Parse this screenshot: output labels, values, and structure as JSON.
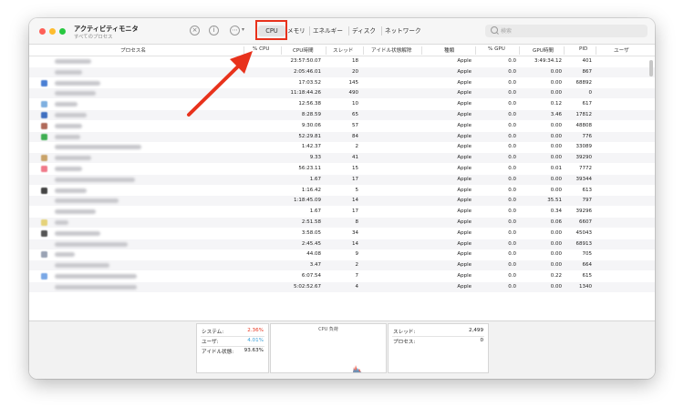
{
  "window": {
    "app_title": "アクティビティモニタ",
    "app_subtitle": "すべてのプロセス"
  },
  "toolbar": {
    "tabs": [
      "CPU",
      "メモリ",
      "エネルギー",
      "ディスク",
      "ネットワーク"
    ],
    "selected_tab": "CPU",
    "search_placeholder": "検索",
    "icons": [
      "stop-icon",
      "info-icon",
      "more-icon"
    ]
  },
  "columns": [
    "プロセス名",
    "% CPU",
    "CPU時間",
    "スレッド",
    "アイドル状態解除",
    "種類",
    "% GPU",
    "GPU時間",
    "PID",
    "ユーザ"
  ],
  "rows": [
    {
      "cpu_time": "23:57:50.07",
      "threads": "18",
      "kind": "Apple",
      "gpu": "0.0",
      "gpu_time": "3:49:34.12",
      "pid": "401"
    },
    {
      "cpu_time": "2:05:46.01",
      "threads": "20",
      "kind": "Apple",
      "gpu": "0.0",
      "gpu_time": "0.00",
      "pid": "867"
    },
    {
      "cpu_time": "17:03.52",
      "threads": "145",
      "kind": "Apple",
      "gpu": "0.0",
      "gpu_time": "0.00",
      "pid": "68892"
    },
    {
      "cpu_time": "11:18:44.26",
      "threads": "490",
      "kind": "Apple",
      "gpu": "0.0",
      "gpu_time": "0.00",
      "pid": "0"
    },
    {
      "cpu_time": "12:56.38",
      "threads": "10",
      "kind": "Apple",
      "gpu": "0.0",
      "gpu_time": "0.12",
      "pid": "617"
    },
    {
      "cpu_time": "8:28.59",
      "threads": "65",
      "kind": "Apple",
      "gpu": "0.0",
      "gpu_time": "3.46",
      "pid": "17812"
    },
    {
      "cpu_time": "9:30.06",
      "threads": "57",
      "kind": "Apple",
      "gpu": "0.0",
      "gpu_time": "0.00",
      "pid": "48808"
    },
    {
      "cpu_time": "52:29.81",
      "threads": "84",
      "kind": "Apple",
      "gpu": "0.0",
      "gpu_time": "0.00",
      "pid": "776"
    },
    {
      "cpu_time": "1:42.37",
      "threads": "2",
      "kind": "Apple",
      "gpu": "0.0",
      "gpu_time": "0.00",
      "pid": "33089"
    },
    {
      "cpu_time": "9.33",
      "threads": "41",
      "kind": "Apple",
      "gpu": "0.0",
      "gpu_time": "0.00",
      "pid": "39290"
    },
    {
      "cpu_time": "56:23.11",
      "threads": "15",
      "kind": "Apple",
      "gpu": "0.0",
      "gpu_time": "0.01",
      "pid": "7772"
    },
    {
      "cpu_time": "1.67",
      "threads": "17",
      "kind": "Apple",
      "gpu": "0.0",
      "gpu_time": "0.00",
      "pid": "39344"
    },
    {
      "cpu_time": "1:16.42",
      "threads": "5",
      "kind": "Apple",
      "gpu": "0.0",
      "gpu_time": "0.00",
      "pid": "613"
    },
    {
      "cpu_time": "1:18:45.09",
      "threads": "14",
      "kind": "Apple",
      "gpu": "0.0",
      "gpu_time": "35.51",
      "pid": "797"
    },
    {
      "cpu_time": "1.67",
      "threads": "17",
      "kind": "Apple",
      "gpu": "0.0",
      "gpu_time": "0.34",
      "pid": "39296"
    },
    {
      "cpu_time": "2:51.58",
      "threads": "8",
      "kind": "Apple",
      "gpu": "0.0",
      "gpu_time": "0.06",
      "pid": "6607"
    },
    {
      "cpu_time": "3:58.05",
      "threads": "34",
      "kind": "Apple",
      "gpu": "0.0",
      "gpu_time": "0.00",
      "pid": "45043"
    },
    {
      "cpu_time": "2:45.45",
      "threads": "14",
      "kind": "Apple",
      "gpu": "0.0",
      "gpu_time": "0.00",
      "pid": "68913"
    },
    {
      "cpu_time": "44.08",
      "threads": "9",
      "kind": "Apple",
      "gpu": "0.0",
      "gpu_time": "0.00",
      "pid": "705"
    },
    {
      "cpu_time": "3.47",
      "threads": "2",
      "kind": "Apple",
      "gpu": "0.0",
      "gpu_time": "0.00",
      "pid": "664"
    },
    {
      "cpu_time": "6:07.54",
      "threads": "7",
      "kind": "Apple",
      "gpu": "0.0",
      "gpu_time": "0.22",
      "pid": "615"
    },
    {
      "cpu_time": "5:02:52.67",
      "threads": "4",
      "kind": "Apple",
      "gpu": "0.0",
      "gpu_time": "0.00",
      "pid": "1340"
    }
  ],
  "summary": {
    "system_label": "システム:",
    "system_value": "2.36%",
    "user_label": "ユーザ:",
    "user_value": "4.01%",
    "idle_label": "アイドル状態:",
    "idle_value": "93.63%",
    "chart_title": "CPU 負荷",
    "threads_label": "スレッド:",
    "threads_value": "2,499",
    "processes_label": "プロセス:",
    "processes_value": "0"
  },
  "colors": {
    "system": "#e8321c",
    "user": "#3aa0d8",
    "highlight": "#e8321c",
    "arrow": "#e8321c"
  }
}
